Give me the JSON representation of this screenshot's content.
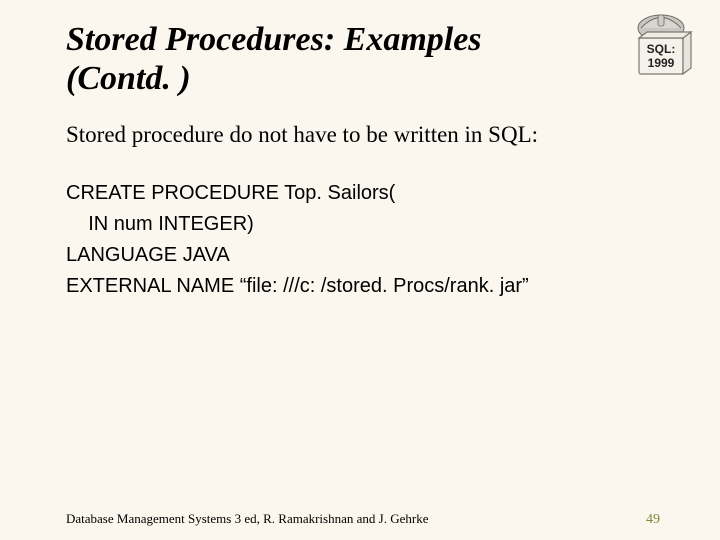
{
  "slide": {
    "title": "Stored Procedures: Examples (Contd. )",
    "intro": "Stored procedure do not have to be written in SQL:",
    "code": {
      "l1": "CREATE PROCEDURE Top. Sailors(",
      "l2": "    IN num INTEGER)",
      "l3": "LANGUAGE JAVA",
      "l4": "EXTERNAL NAME “file: ///c: /stored. Procs/rank. jar”"
    },
    "footer": "Database Management Systems 3 ed,  R. Ramakrishnan and J. Gehrke",
    "page": "49",
    "logo": {
      "label_top": "SQL:",
      "label_bottom": "1999"
    }
  }
}
